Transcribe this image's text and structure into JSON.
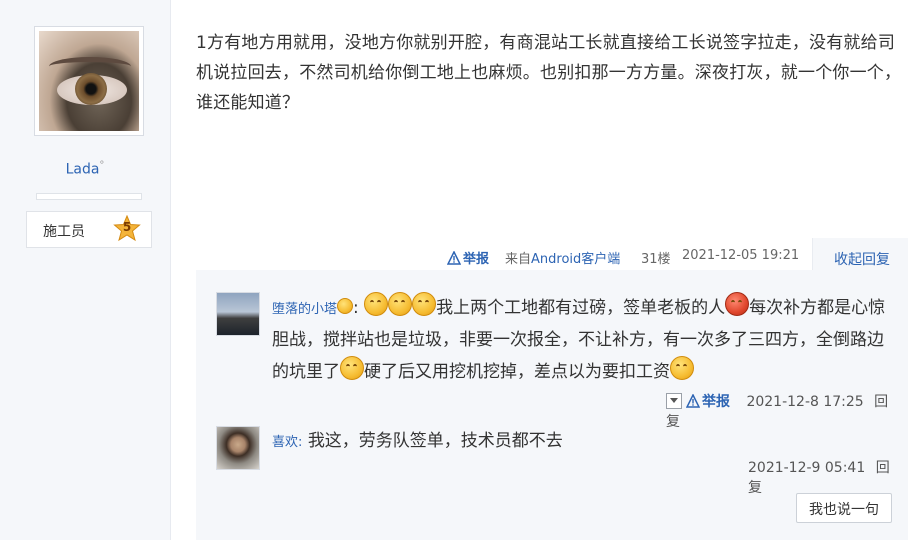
{
  "user": {
    "name": "Lada",
    "name_suffix": "°",
    "rank_label": "施工员",
    "rank_level": "5"
  },
  "post": {
    "text": "1方有地方用就用，没地方你就别开腔，有商混站工长就直接给工长说签字拉走，没有就给司机说拉回去，不然司机给你倒工地上也麻烦。也别扣那一方方量。深夜打灰，就一个你一个，谁还能知道？",
    "report_label": "举报",
    "from_prefix": "来自",
    "from_app": "Android客户端",
    "floor": "31楼",
    "time": "2021-12-05 19:21",
    "collapse_label": "收起回复"
  },
  "replies": [
    {
      "name": "堕落的小塔",
      "text_a": "我上两个工地都有过磅，签单老板的人",
      "text_b": "每次补方都是心惊胆战，搅拌站也是垃圾，非要一次报全，不让补方，有一次多了三四方，全倒路边的坑里了",
      "text_c": "硬了后又用挖机挖掉，差点以为要扣工资",
      "report_label": "举报",
      "time": "2021-12-8 17:25",
      "reply_label": "回复"
    },
    {
      "name": "喜欢",
      "text": "我这，劳务队签单，技术员都不去",
      "time": "2021-12-9 05:41",
      "reply_label": "回复"
    }
  ],
  "say_button": "我也说一句",
  "colors": {
    "link": "#2d64b3",
    "sidebar_bg": "#f5f7fa",
    "reply_bg": "#f5f7fa"
  }
}
